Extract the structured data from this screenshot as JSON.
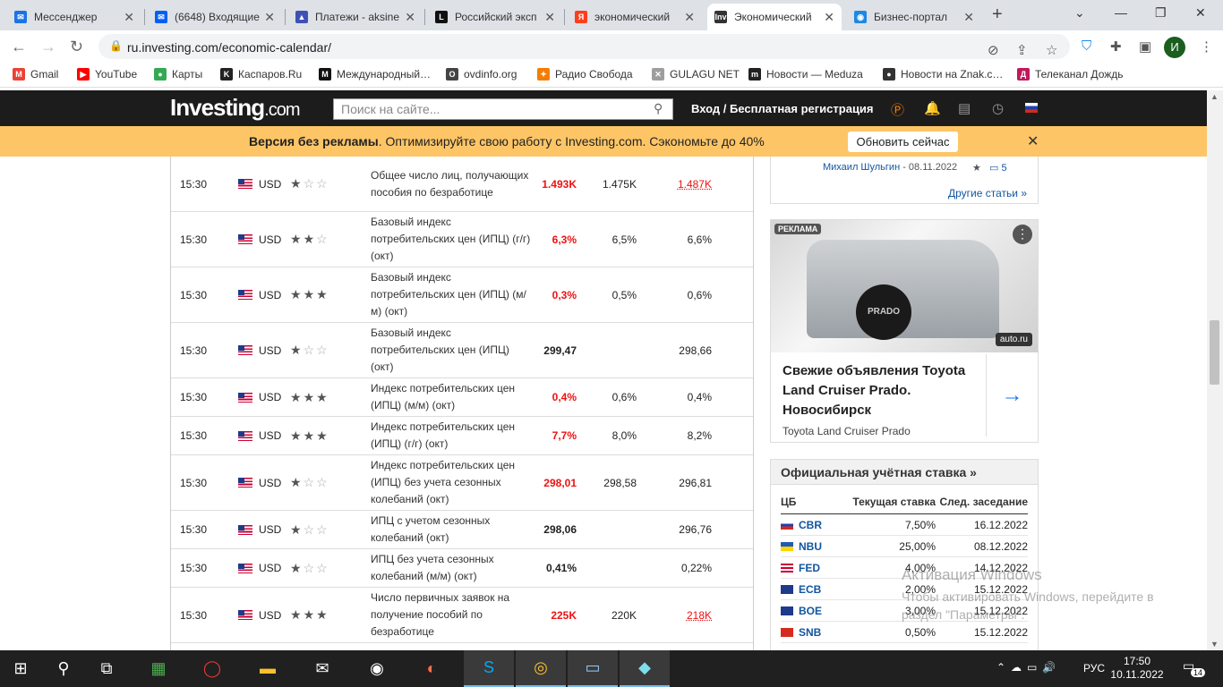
{
  "browser": {
    "tabs": [
      {
        "title": "Мессенджер",
        "icon": "messenger-icon",
        "color": "#1a73e8",
        "glyph": "✉"
      },
      {
        "title": "(6648) Входящие",
        "icon": "mail-icon",
        "color": "#005ff9",
        "glyph": "✉"
      },
      {
        "title": "Платежи - aksine",
        "icon": "cap-icon",
        "color": "#3f51b5",
        "glyph": "▲"
      },
      {
        "title": "Российский эксп",
        "icon": "l-logo-icon",
        "color": "#111111",
        "glyph": "L"
      },
      {
        "title": "экономический",
        "icon": "yandex-icon",
        "color": "#fc3f1d",
        "glyph": "Я"
      },
      {
        "title": "Экономический",
        "icon": "investing-icon",
        "color": "#333333",
        "glyph": "Inv"
      },
      {
        "title": "Бизнес-портал",
        "icon": "globe-icon",
        "color": "#1e88e5",
        "glyph": "◉"
      }
    ],
    "active_tab": 5,
    "url": "ru.investing.com/economic-calendar/",
    "profile_initial": "И",
    "bookmarks": [
      {
        "label": "Gmail",
        "color": "#ea4335",
        "glyph": "M"
      },
      {
        "label": "YouTube",
        "color": "#ff0000",
        "glyph": "▶"
      },
      {
        "label": "Карты",
        "color": "#34a853",
        "glyph": "●"
      },
      {
        "label": "Каспаров.Ru",
        "color": "#222222",
        "glyph": "K"
      },
      {
        "label": "Международный…",
        "color": "#111111",
        "glyph": "M"
      },
      {
        "label": "ovdinfo.org",
        "color": "#444444",
        "glyph": "O"
      },
      {
        "label": "Радио Свобода",
        "color": "#f57c00",
        "glyph": "✦"
      },
      {
        "label": "GULAGU NET",
        "color": "#9e9e9e",
        "glyph": "✕"
      },
      {
        "label": "Новости — Meduza",
        "color": "#222222",
        "glyph": "m"
      },
      {
        "label": "Новости на Znak.c…",
        "color": "#333333",
        "glyph": "●"
      },
      {
        "label": "Телеканал Дождь",
        "color": "#c2185b",
        "glyph": "Д"
      }
    ]
  },
  "site": {
    "logo_main": "Investing",
    "logo_suffix": ".com",
    "search_placeholder": "Поиск на сайте...",
    "login": "Вход / Бесплатная регистрация",
    "promo_bold": "Версия без рекламы",
    "promo_text": ". Оптимизируйте свою работу с Investing.com. Сэкономьте до 40%",
    "promo_button": "Обновить сейчас"
  },
  "calendar": {
    "rows": [
      {
        "time": "15:30",
        "currency": "USD",
        "stars": 1,
        "event": "Общее число лиц, получающих пособия по безработице",
        "actual": "1.493K",
        "actual_color": "red",
        "forecast": "1.475K",
        "previous": "1.487K",
        "previous_style": "red-underline",
        "height": 62
      },
      {
        "time": "15:30",
        "currency": "USD",
        "stars": 2,
        "event": "Базовый индекс потребительских цен (ИПЦ) (г/г) (окт)",
        "actual": "6,3%",
        "actual_color": "red",
        "forecast": "6,5%",
        "previous": "6,6%",
        "previous_style": "",
        "height": 62
      },
      {
        "time": "15:30",
        "currency": "USD",
        "stars": 3,
        "event": "Базовый индекс потребительских цен (ИПЦ) (м/м) (окт)",
        "actual": "0,3%",
        "actual_color": "red",
        "forecast": "0,5%",
        "previous": "0,6%",
        "previous_style": "",
        "height": 62
      },
      {
        "time": "15:30",
        "currency": "USD",
        "stars": 1,
        "event": "Базовый индекс потребительских цен (ИПЦ) (окт)",
        "actual": "299,47",
        "actual_color": "black",
        "forecast": "",
        "previous": "298,66",
        "previous_style": "",
        "height": 62
      },
      {
        "time": "15:30",
        "currency": "USD",
        "stars": 3,
        "event": "Индекс потребительских цен (ИПЦ) (м/м) (окт)",
        "actual": "0,4%",
        "actual_color": "red",
        "forecast": "0,6%",
        "previous": "0,4%",
        "previous_style": "",
        "height": 43
      },
      {
        "time": "15:30",
        "currency": "USD",
        "stars": 3,
        "event": "Индекс потребительских цен (ИПЦ) (г/г) (окт)",
        "actual": "7,7%",
        "actual_color": "red",
        "forecast": "8,0%",
        "previous": "8,2%",
        "previous_style": "",
        "height": 43
      },
      {
        "time": "15:30",
        "currency": "USD",
        "stars": 1,
        "event": "Индекс потребительских цен (ИПЦ) без учета сезонных колебаний (окт)",
        "actual": "298,01",
        "actual_color": "red",
        "forecast": "298,58",
        "previous": "296,81",
        "previous_style": "",
        "height": 62
      },
      {
        "time": "15:30",
        "currency": "USD",
        "stars": 1,
        "event": "ИПЦ с учетом сезонных колебаний (окт)",
        "actual": "298,06",
        "actual_color": "black",
        "forecast": "",
        "previous": "296,76",
        "previous_style": "",
        "height": 43
      },
      {
        "time": "15:30",
        "currency": "USD",
        "stars": 1,
        "event": "ИПЦ без учета сезонных колебаний (м/м) (окт)",
        "actual": "0,41%",
        "actual_color": "black",
        "forecast": "",
        "previous": "0,22%",
        "previous_style": "",
        "height": 43
      },
      {
        "time": "15:30",
        "currency": "USD",
        "stars": 3,
        "event": "Число первичных заявок на получение пособий по безработице",
        "actual": "225K",
        "actual_color": "red",
        "forecast": "220K",
        "previous": "218K",
        "previous_style": "red-underline",
        "height": 62
      },
      {
        "time": "",
        "currency": "",
        "stars": 0,
        "event": "",
        "actual": "",
        "actual_color": "black",
        "forecast": "",
        "previous": "",
        "previous_style": "",
        "height": 20
      }
    ]
  },
  "sidebar": {
    "author": "Михаил Шульгин",
    "author_date": " - 08.11.2022",
    "comments": "5",
    "other_articles": "Другие статьи »",
    "ad_label": "РЕКЛАМА",
    "ad_source": "auto.ru",
    "ad_wheel_text": "PRADO",
    "ad_title": "Свежие объявления Toyota Land Cruiser Prado. Новосибирск",
    "ad_subtitle": "Toyota Land Cruiser Prado",
    "rates_title": "Официальная учётная ставка »",
    "rates_headers": {
      "bank": "ЦБ",
      "rate": "Текущая ставка",
      "next": "След. заседание"
    },
    "rates": [
      {
        "bank": "CBR",
        "rate": "7,50%",
        "next": "16.12.2022",
        "flag": "ru"
      },
      {
        "bank": "NBU",
        "rate": "25,00%",
        "next": "08.12.2022",
        "flag": "ua"
      },
      {
        "bank": "FED",
        "rate": "4,00%",
        "next": "14.12.2022",
        "flag": "us"
      },
      {
        "bank": "ECB",
        "rate": "2,00%",
        "next": "15.12.2022",
        "flag": "eu"
      },
      {
        "bank": "BOE",
        "rate": "3,00%",
        "next": "15.12.2022",
        "flag": "gb"
      },
      {
        "bank": "SNB",
        "rate": "0,50%",
        "next": "15.12.2022",
        "flag": "ch"
      }
    ]
  },
  "windows": {
    "watermark_title": "Активация Windows",
    "watermark_text": "Чтобы активировать Windows, перейдите в раздел \"Параметры\".",
    "lang": "РУС",
    "time": "17:50",
    "date": "10.11.2022",
    "notifications": "14"
  }
}
